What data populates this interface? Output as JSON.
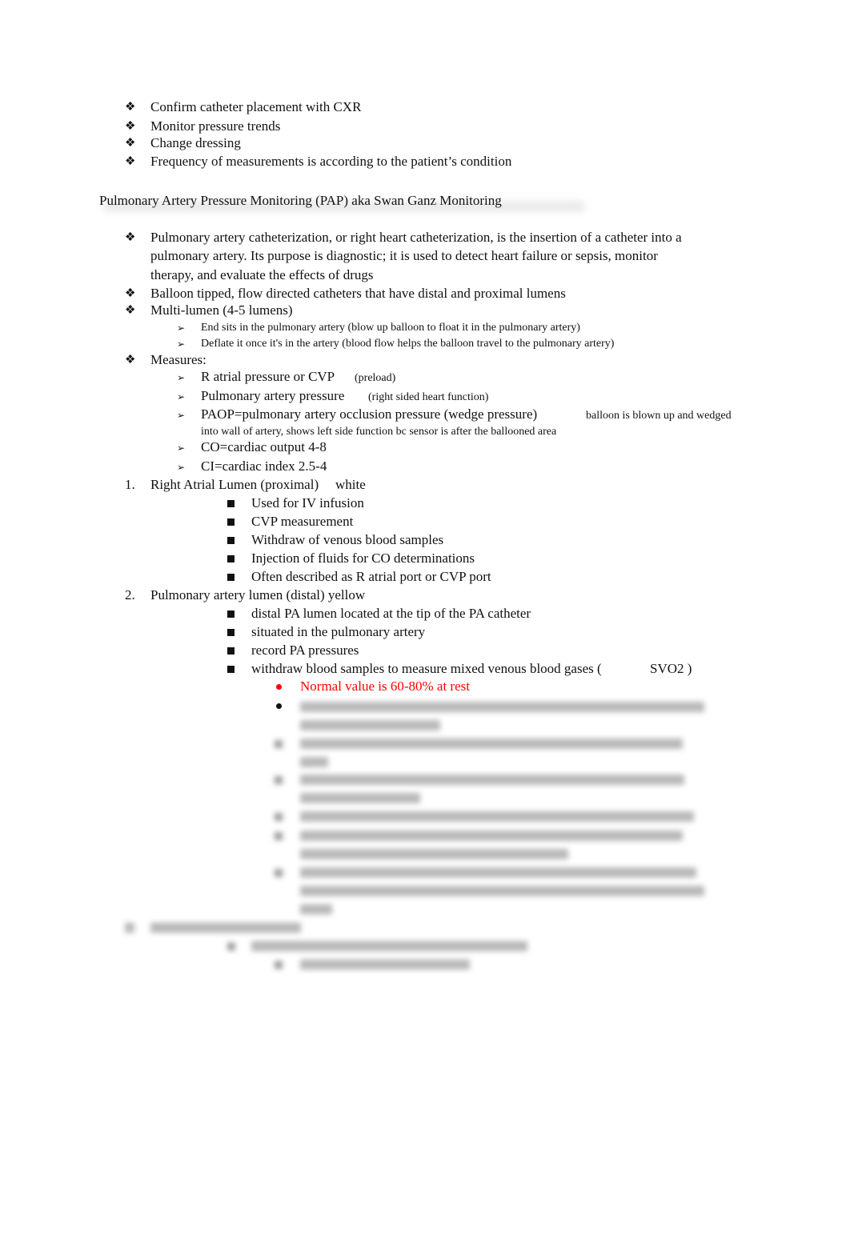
{
  "top_bullets": [
    "Confirm catheter placement with CXR",
    "Monitor pressure trends",
    "Change dressing",
    "Frequency of measurements is according to the patient’s condition"
  ],
  "section_heading": "Pulmonary Artery Pressure Monitoring (PAP) aka Swan Ganz Monitoring",
  "intro": {
    "line1": "Pulmonary artery catheterization, or right heart catheterization, is the insertion of a catheter into a",
    "line2": "pulmonary artery. Its purpose is diagnostic; it is used to detect heart failure or sepsis, monitor",
    "line3": "therapy, and evaluate the effects of drugs"
  },
  "balloon": "Balloon tipped, flow directed catheters that have distal and proximal lumens",
  "multilumen": {
    "label": "Multi-lumen (4-5 lumens)",
    "sub": [
      "End sits in the pulmonary artery (blow up balloon to float it in the pulmonary artery)",
      "Deflate it once it's in the artery (blood flow helps the balloon travel to the pulmonary artery)"
    ]
  },
  "measures": {
    "label": "Measures:",
    "items": [
      {
        "main": "R atrial pressure or CVP",
        "note": "(preload)"
      },
      {
        "main": "Pulmonary artery pressure",
        "note": "(right sided heart function)"
      },
      {
        "main": "PAOP=pulmonary artery occlusion pressure (wedge pressure)",
        "note": "balloon is blown up and wedged",
        "note2": "into wall of artery, shows left side function bc sensor is after the ballooned area"
      },
      {
        "main": "CO=cardiac output 4-8"
      },
      {
        "main": "CI=cardiac index 2.5-4"
      }
    ]
  },
  "lumens": [
    {
      "number": "1.",
      "title": "Right Atrial Lumen (proximal)",
      "color": "white",
      "items": [
        "Used for IV infusion",
        "CVP measurement",
        "Withdraw of venous blood samples",
        "Injection of fluids for CO determinations",
        "Often described as R atrial port or CVP port"
      ]
    },
    {
      "number": "2.",
      "title": "Pulmonary artery lumen (distal) yellow",
      "items": [
        "distal PA lumen located at the tip of the PA catheter",
        "situated in the pulmonary artery",
        "record PA pressures",
        "withdraw blood samples to measure mixed venous blood gases (",
        "SVO2 )"
      ],
      "sub_red": "Normal value is 60-80% at rest"
    }
  ],
  "colors": {
    "text": "#111111",
    "highlight_red": "#ff0000"
  }
}
